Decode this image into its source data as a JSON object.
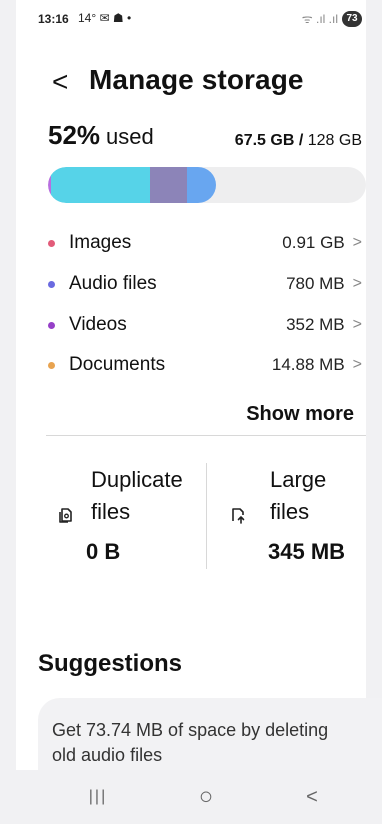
{
  "status_bar": {
    "time": "13:16",
    "left_icons": "14° ✉ ☗ •",
    "signal_text": "ᯤ .ıl .ıl",
    "battery": "73"
  },
  "header": {
    "back_glyph": "<",
    "title": "Manage storage"
  },
  "usage": {
    "percent": "52%",
    "used_word": "used",
    "used_amount": "67.5 GB /",
    "total": "128 GB",
    "bar_fraction": 0.527,
    "bar_colors": {
      "images": "#b86ee0",
      "apps": "#56d3e8",
      "system": "#8c84b8",
      "other": "#68a6f0"
    }
  },
  "categories": [
    {
      "name": "Images",
      "size": "0.91 GB",
      "color": "#e25b79"
    },
    {
      "name": "Audio files",
      "size": "780 MB",
      "color": "#6a6ae0"
    },
    {
      "name": "Videos",
      "size": "352 MB",
      "color": "#9640c8"
    },
    {
      "name": "Documents",
      "size": "14.88 MB",
      "color": "#e8a350"
    }
  ],
  "chevron": ">",
  "show_more": "Show more",
  "tiles": {
    "duplicate": {
      "line1": "Duplicate",
      "line2": "files",
      "value": "0 B",
      "icon": "copy-file-icon"
    },
    "large": {
      "line1": "Large",
      "line2": "files",
      "value": "345 MB",
      "icon": "file-upload-icon"
    }
  },
  "suggestions": {
    "title": "Suggestions",
    "card_text": "Get 73.74 MB of space by deleting old audio files"
  },
  "nav": {
    "recents": "|||",
    "home": "○",
    "back": "<"
  }
}
